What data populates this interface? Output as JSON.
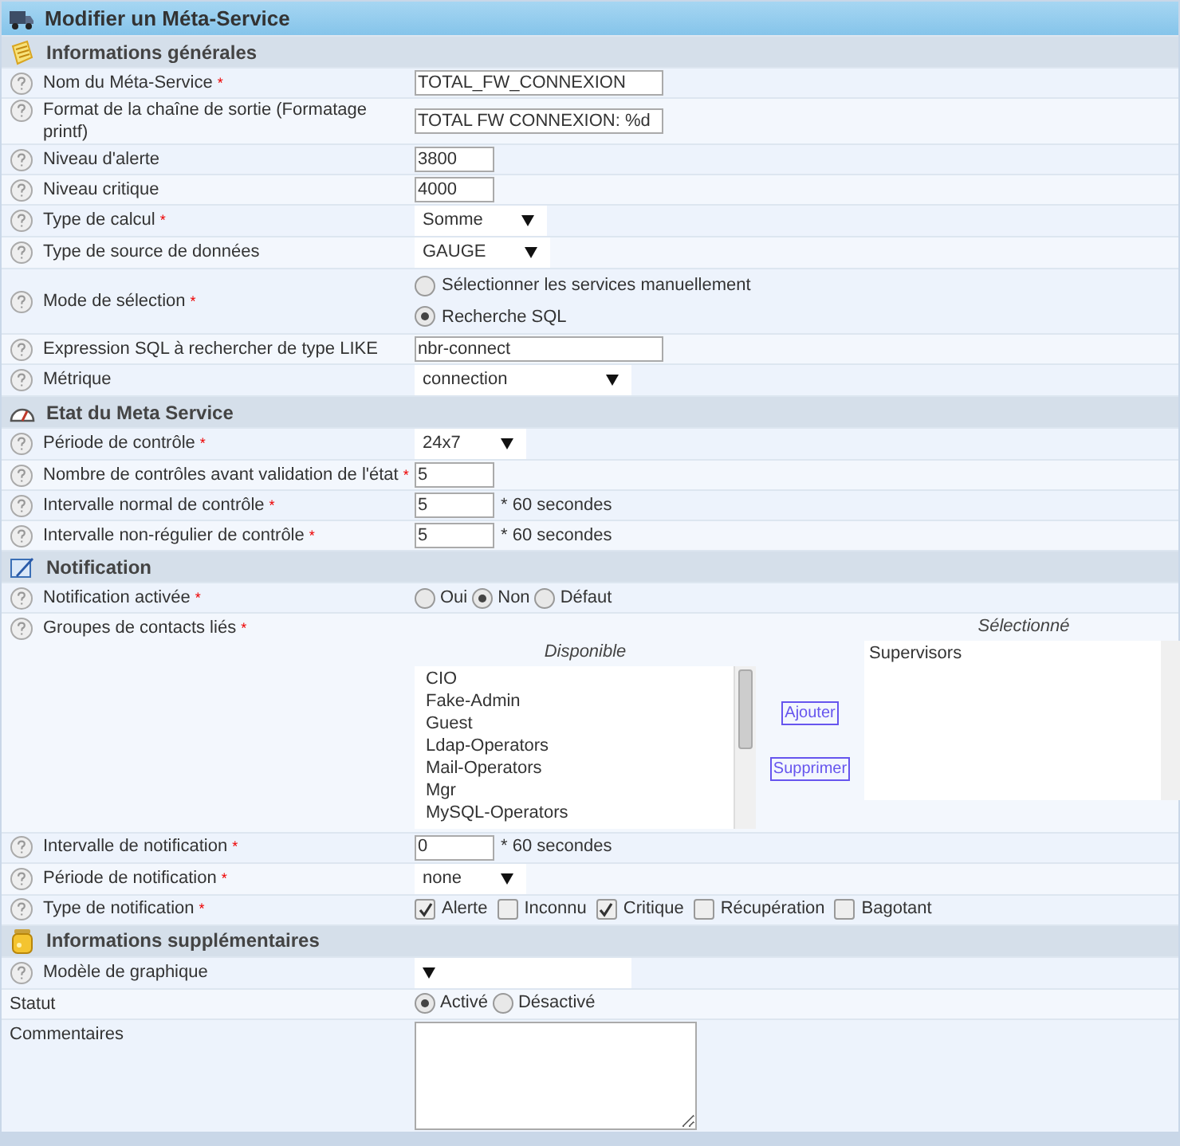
{
  "title": "Modifier un Méta-Service",
  "sections": [
    {
      "title": "Informations générales",
      "rows": [
        {
          "kind": "text",
          "label": "Nom du Méta-Service",
          "mark": "*",
          "help": true,
          "value": "TOTAL_FW_CONNEXION"
        },
        {
          "kind": "text",
          "label": "Format de la chaîne de sortie (Formatage printf)",
          "help": true,
          "value": "TOTAL FW CONNEXION: %d"
        },
        {
          "kind": "number",
          "label": "Niveau d'alerte",
          "help": true,
          "value": "3800"
        },
        {
          "kind": "number",
          "label": "Niveau critique",
          "help": true,
          "value": "4000"
        },
        {
          "kind": "select",
          "label": "Type de calcul",
          "mark": "*",
          "help": true,
          "value": "Somme"
        },
        {
          "kind": "select",
          "label": "Type de source de données",
          "help": true,
          "value": "GAUGE"
        },
        {
          "kind": "radio-stack",
          "label": "Mode de sélection",
          "mark": "*",
          "help": true,
          "options": [
            {
              "label": "Sélectionner les services manuellement",
              "selected": false
            },
            {
              "label": "Recherche SQL",
              "selected": true
            }
          ]
        },
        {
          "kind": "text",
          "label": "Expression SQL à rechercher de type LIKE",
          "help": true,
          "value": "nbr-connect"
        },
        {
          "kind": "select-wide",
          "label": "Métrique",
          "help": true,
          "value": "connection"
        }
      ]
    },
    {
      "title": "Etat du Meta Service",
      "rows": [
        {
          "kind": "select",
          "label": "Période de contrôle",
          "mark": "*",
          "help": true,
          "value": "24x7"
        },
        {
          "kind": "number",
          "label": "Nombre de contrôles avant validation de l'état",
          "mark": "*",
          "help": true,
          "value": "5"
        },
        {
          "kind": "number",
          "label": "Intervalle normal de contrôle",
          "mark": "*",
          "help": true,
          "value": "5",
          "suffix": "* 60 secondes"
        },
        {
          "kind": "number",
          "label": "Intervalle non-régulier de contrôle",
          "mark": "*",
          "help": true,
          "value": "5",
          "suffix": "* 60 secondes"
        }
      ]
    },
    {
      "title": "Notification",
      "rows": [
        {
          "kind": "radio",
          "label": "Notification activée",
          "mark": "*",
          "help": true,
          "options": [
            {
              "label": "Oui",
              "selected": false
            },
            {
              "label": "Non",
              "selected": true
            },
            {
              "label": "Défaut",
              "selected": false
            }
          ]
        },
        {
          "kind": "listpair",
          "label": "Groupes de contacts liés",
          "mark": "*",
          "help": true,
          "available_title": "Disponible",
          "available": [
            "CIO",
            "Fake-Admin",
            "Guest",
            "Ldap-Operators",
            "Mail-Operators",
            "Mgr",
            "MySQL-Operators"
          ],
          "buttons": [
            "Ajouter",
            "Supprimer"
          ],
          "selected_title": "Sélectionné",
          "chosen": [
            "Supervisors"
          ]
        },
        {
          "kind": "number",
          "label": "Intervalle de notification",
          "mark": "*",
          "help": true,
          "value": "0",
          "suffix": "* 60 secondes"
        },
        {
          "kind": "select",
          "label": "Période de notification",
          "mark": "*",
          "help": true,
          "value": "none"
        },
        {
          "kind": "checks",
          "label": "Type de notification",
          "mark": "*",
          "help": true,
          "options": [
            {
              "label": "Alerte",
              "checked": true
            },
            {
              "label": "Inconnu",
              "checked": false
            },
            {
              "label": "Critique",
              "checked": true
            },
            {
              "label": "Récupération",
              "checked": false
            },
            {
              "label": "Bagotant",
              "checked": false
            }
          ]
        }
      ]
    },
    {
      "title": "Informations supplémentaires",
      "rows": [
        {
          "kind": "select-wide",
          "label": "Modèle de graphique",
          "help": true
        },
        {
          "kind": "radio",
          "label": "Statut",
          "help": false,
          "options": [
            {
              "label": "Activé",
              "selected": true
            },
            {
              "label": "Désactivé",
              "selected": false
            }
          ]
        },
        {
          "kind": "textarea",
          "label": "Commentaires",
          "help": false
        }
      ]
    }
  ]
}
